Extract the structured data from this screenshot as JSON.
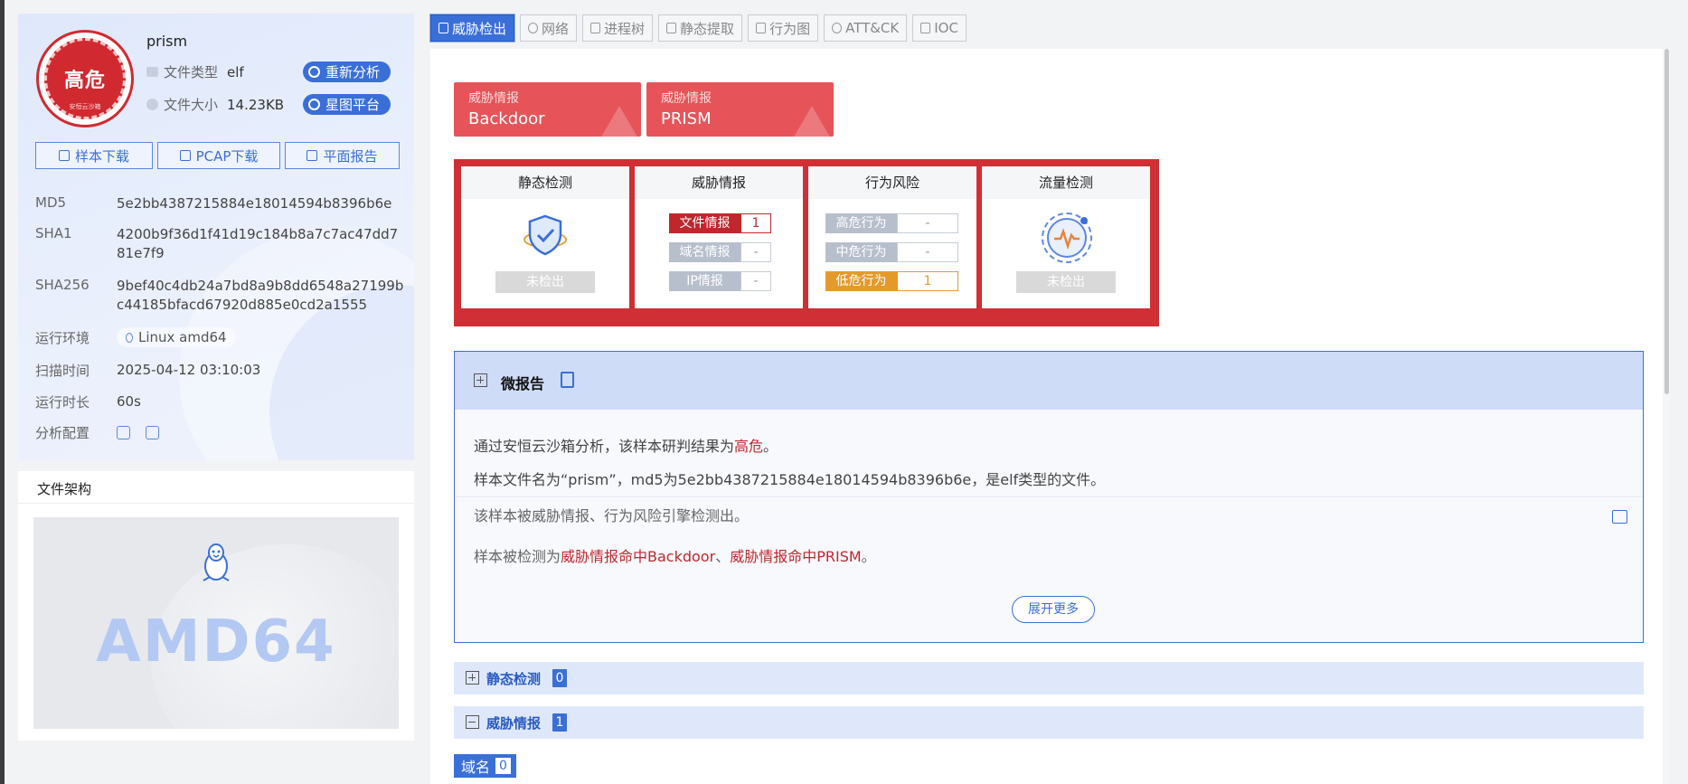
{
  "sample": {
    "verdict": "高危",
    "verdict_sub": "安恒云沙箱",
    "name": "prism",
    "type_label": "文件类型",
    "type_value": "elf",
    "size_label": "文件大小",
    "size_value": "14.23KB",
    "reanalyze": "重新分析",
    "platform": "星图平台",
    "downloads": [
      "样本下载",
      "PCAP下载",
      "平面报告"
    ]
  },
  "hashes": [
    {
      "label": "MD5",
      "value": "5e2bb4387215884e18014594b8396b6e"
    },
    {
      "label": "SHA1",
      "value": "4200b9f36d1f41d19c184b8a7c7ac47dd781e7f9"
    },
    {
      "label": "SHA256",
      "value": "9bef40c4db24a7bd8a9b8dd6548a27199bc44185bfacd67920d885e0cd2a1555"
    }
  ],
  "info": {
    "env_label": "运行环境",
    "env_value": "Linux amd64",
    "scan_label": "扫描时间",
    "scan_value": "2025-04-12 03:10:03",
    "dur_label": "运行时长",
    "dur_value": "60s",
    "cfg_label": "分析配置"
  },
  "arch": {
    "title": "文件架构",
    "value": "AMD64"
  },
  "tabs": [
    "威胁检出",
    "网络",
    "进程树",
    "静态提取",
    "行为图",
    "ATT&CK",
    "IOC"
  ],
  "intel_cards": [
    {
      "kind": "威胁情报",
      "name": "Backdoor"
    },
    {
      "kind": "威胁情报",
      "name": "PRISM"
    }
  ],
  "detect": {
    "static": {
      "title": "静态检测",
      "status": "未检出"
    },
    "intel": {
      "title": "威胁情报",
      "rows": [
        {
          "label": "文件情报",
          "value": "1"
        },
        {
          "label": "域名情报",
          "value": "-"
        },
        {
          "label": "IP情报",
          "value": "-"
        }
      ]
    },
    "behavior": {
      "title": "行为风险",
      "rows": [
        {
          "label": "高危行为",
          "value": "-"
        },
        {
          "label": "中危行为",
          "value": "-"
        },
        {
          "label": "低危行为",
          "value": "1"
        }
      ]
    },
    "traffic": {
      "title": "流量检测",
      "status": "未检出"
    },
    "colors": {
      "frame": "#cf2f35",
      "red": "#c0272d",
      "orange": "#e49a2b",
      "grey": "#b7bfcc"
    }
  },
  "report": {
    "title": "微报告",
    "p1_pre": "通过安恒云沙箱分析，该样本研判结果为",
    "p1_hl": "高危",
    "p1_post": "。",
    "p2": "样本文件名为“prism”，md5为5e2bb4387215884e18014594b8396b6e，是elf类型的文件。",
    "p3": "该样本被威胁情报、行为风险引擎检测出。",
    "p4_pre": "样本被检测为",
    "p4_hl1": "威胁情报命中Backdoor",
    "p4_sep": "、",
    "p4_hl2": "威胁情报命中PRISM",
    "p4_post": "。",
    "expand": "展开更多"
  },
  "sections": [
    {
      "title": "静态检测",
      "count": "0"
    },
    {
      "title": "威胁情报",
      "count": "1"
    }
  ],
  "domain_tag": {
    "label": "域名",
    "count": "0"
  }
}
